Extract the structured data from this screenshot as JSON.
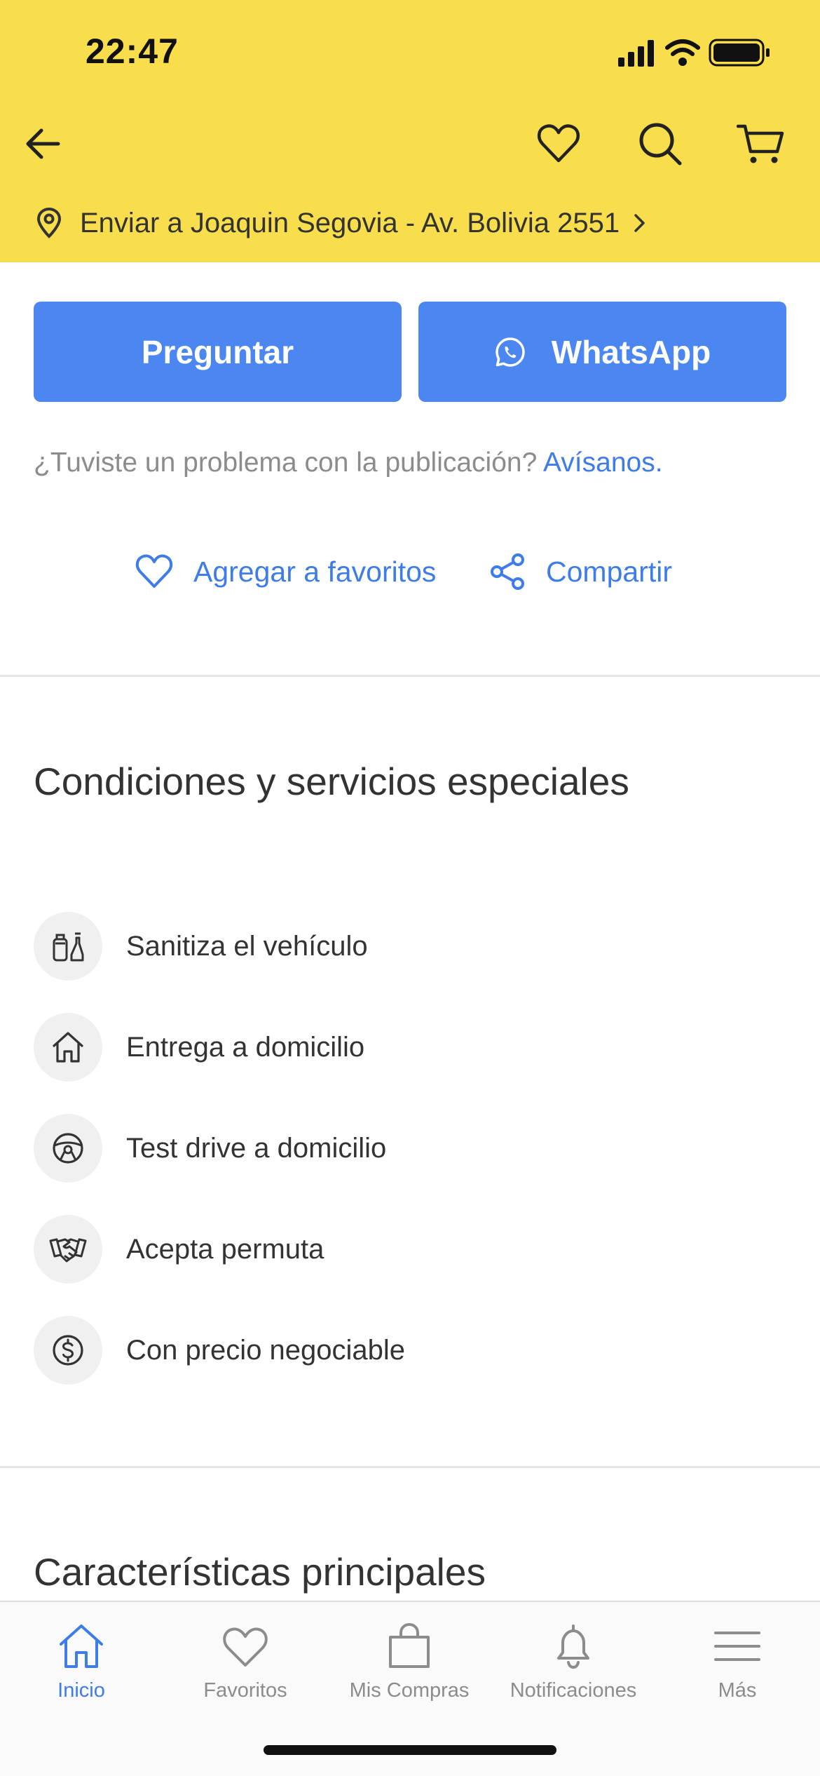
{
  "status_bar": {
    "time": "22:47"
  },
  "header": {
    "address": "Enviar a Joaquin Segovia - Av. Bolivia 2551"
  },
  "actions": {
    "ask_label": "Preguntar",
    "whatsapp_label": "WhatsApp",
    "problem_text": "¿Tuviste un problema con la publicación?",
    "problem_link": "Avísanos.",
    "favorite_label": "Agregar a favoritos",
    "share_label": "Compartir"
  },
  "conditions": {
    "title": "Condiciones y servicios especiales",
    "items": [
      {
        "label": "Sanitiza el vehículo",
        "icon": "sanitize-icon"
      },
      {
        "label": "Entrega a domicilio",
        "icon": "home-icon"
      },
      {
        "label": "Test drive a domicilio",
        "icon": "steering-wheel-icon"
      },
      {
        "label": "Acepta permuta",
        "icon": "handshake-icon"
      },
      {
        "label": "Con precio negociable",
        "icon": "dollar-icon"
      }
    ]
  },
  "features": {
    "title": "Características principales"
  },
  "tabbar": {
    "items": [
      {
        "label": "Inicio",
        "icon": "home-icon",
        "active": true
      },
      {
        "label": "Favoritos",
        "icon": "heart-icon",
        "active": false
      },
      {
        "label": "Mis Compras",
        "icon": "bag-icon",
        "active": false
      },
      {
        "label": "Notificaciones",
        "icon": "bell-icon",
        "active": false
      },
      {
        "label": "Más",
        "icon": "menu-icon",
        "active": false
      }
    ]
  },
  "colors": {
    "header_bg": "#F8DD4D",
    "primary_button": "#4C86F0",
    "link": "#3E7CE8"
  }
}
